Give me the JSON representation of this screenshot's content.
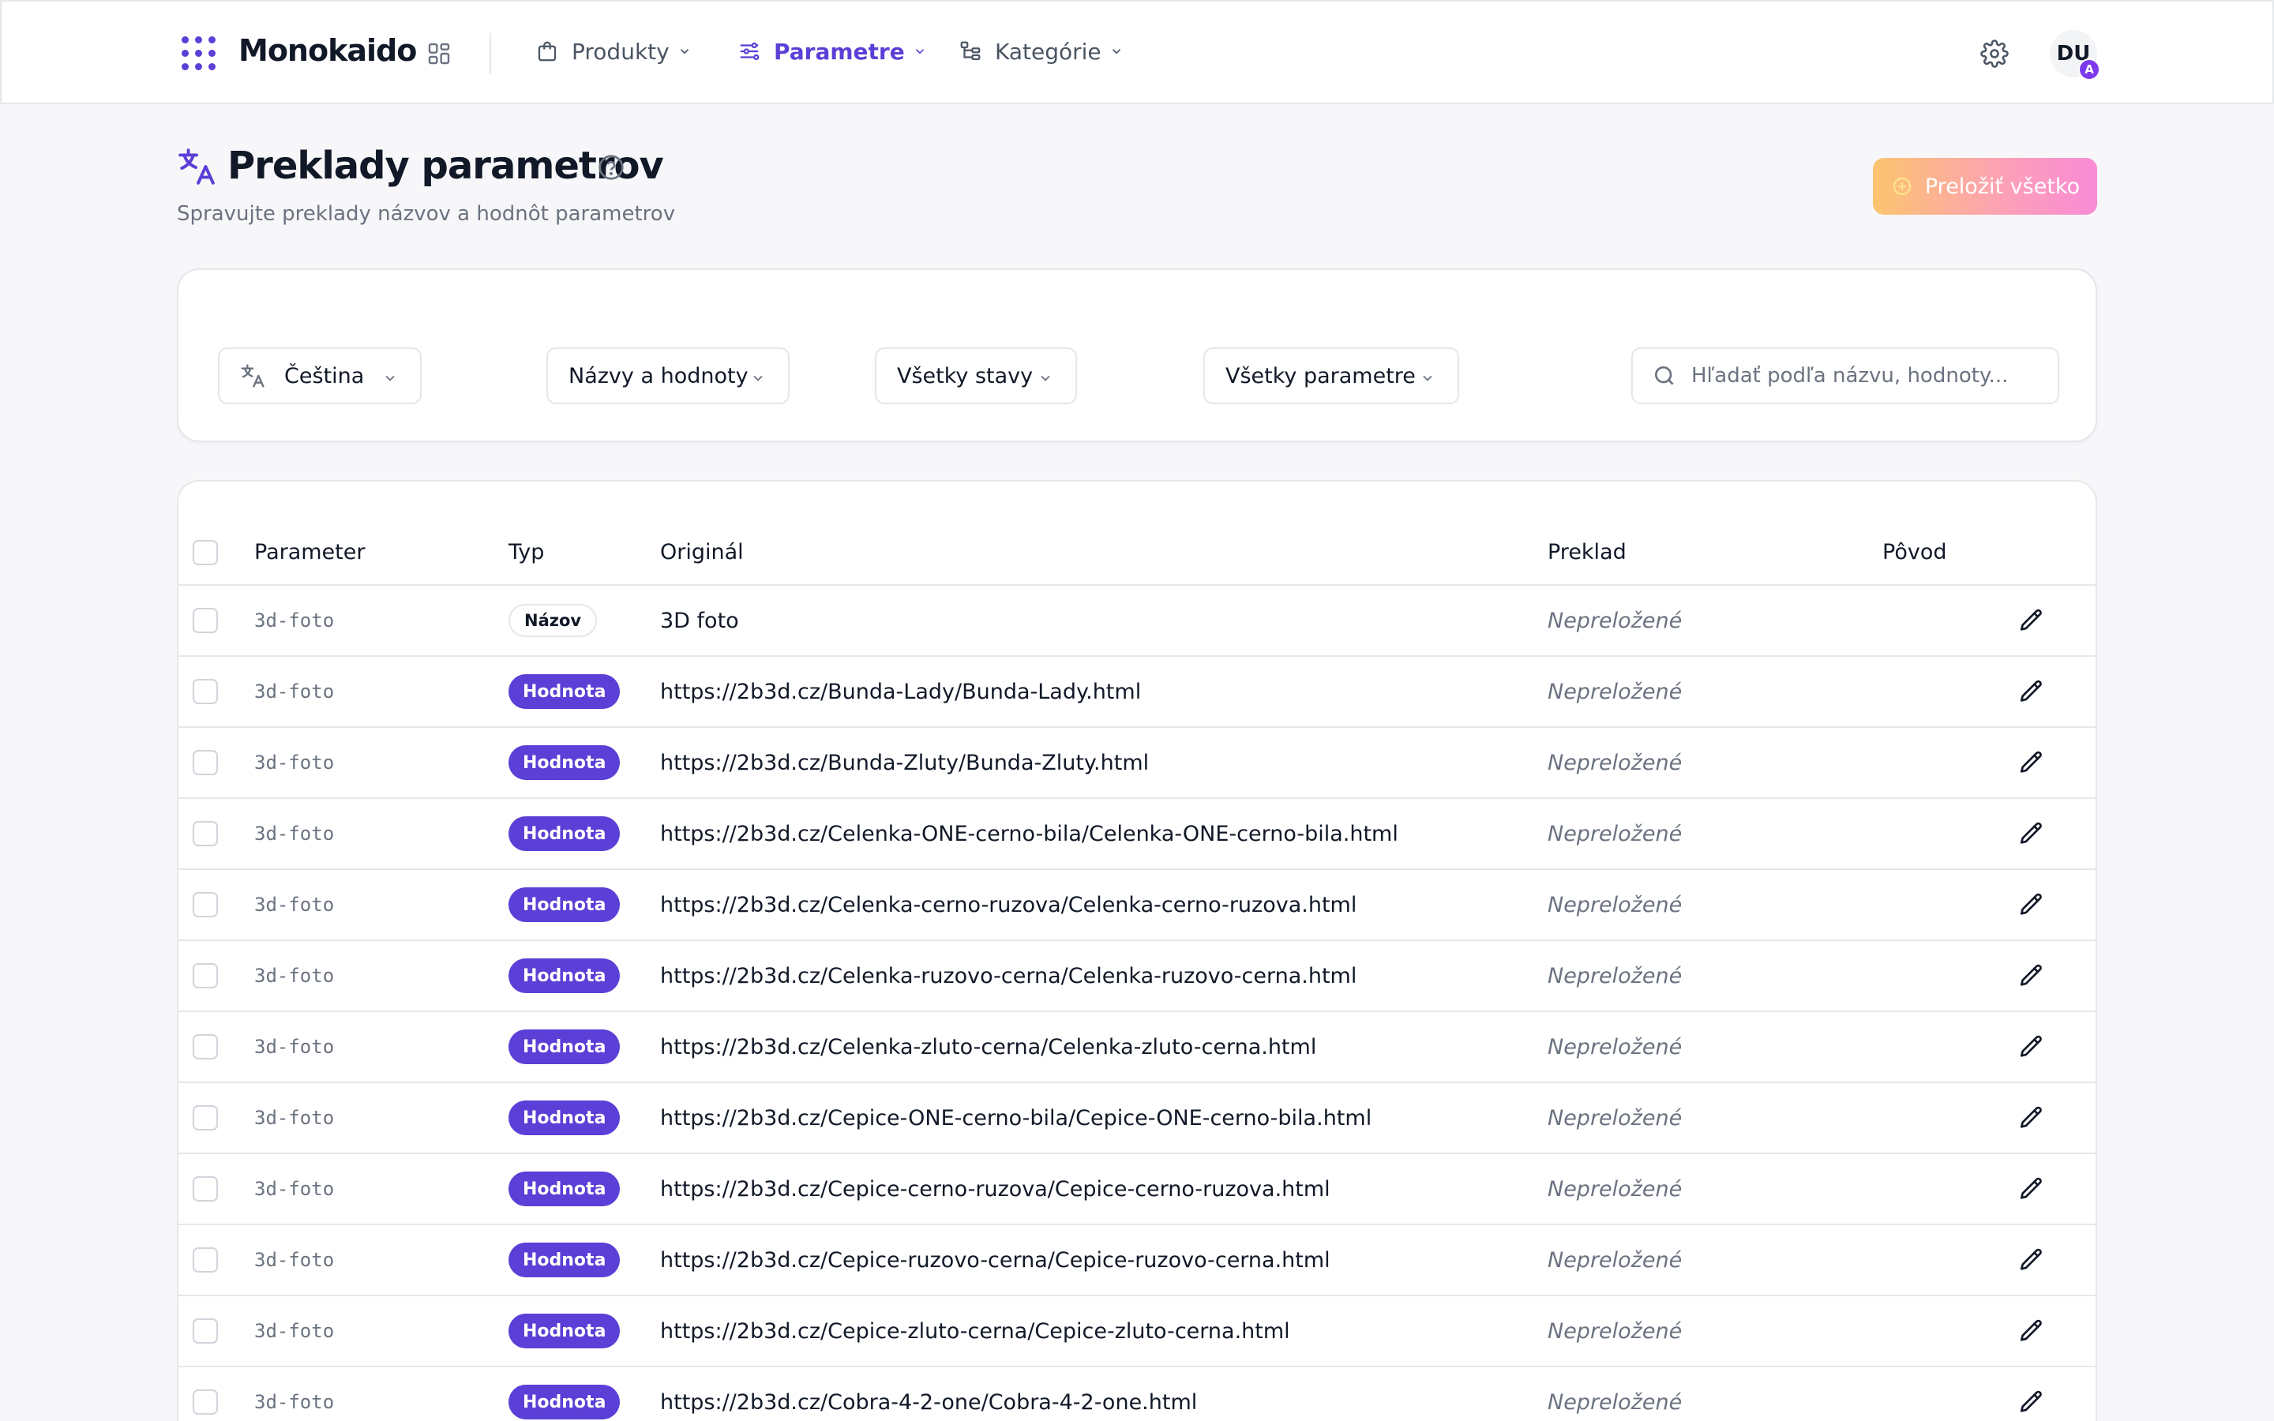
{
  "header": {
    "brand": "Monokaido",
    "nav": [
      {
        "label": "Produkty",
        "icon": "shopping-bag-icon",
        "active": false
      },
      {
        "label": "Parametre",
        "icon": "sliders-icon",
        "active": true
      },
      {
        "label": "Kategórie",
        "icon": "tree-structure-icon",
        "active": false
      }
    ],
    "avatar_initials": "DU",
    "avatar_badge": "A"
  },
  "page": {
    "title": "Preklady parametrov",
    "subtitle": "Spravujte preklady názvov a hodnôt parametrov",
    "translate_all_label": "Preložiť všetko"
  },
  "filters": {
    "language": "Čeština",
    "scope": "Názvy a hodnoty",
    "status": "Všetky stavy",
    "parameters": "Všetky parametre",
    "search_placeholder": "Hľadať podľa názvu, hodnoty..."
  },
  "table": {
    "columns": {
      "parameter": "Parameter",
      "type": "Typ",
      "original": "Originál",
      "translation": "Preklad",
      "source": "Pôvod"
    },
    "rows": [
      {
        "parameter": "3d-foto",
        "type": "Názov",
        "kind": "name",
        "original": "3D foto",
        "translation": "Nepreložené"
      },
      {
        "parameter": "3d-foto",
        "type": "Hodnota",
        "kind": "value",
        "original": "https://2b3d.cz/Bunda-Lady/Bunda-Lady.html",
        "translation": "Nepreložené"
      },
      {
        "parameter": "3d-foto",
        "type": "Hodnota",
        "kind": "value",
        "original": "https://2b3d.cz/Bunda-Zluty/Bunda-Zluty.html",
        "translation": "Nepreložené"
      },
      {
        "parameter": "3d-foto",
        "type": "Hodnota",
        "kind": "value",
        "original": "https://2b3d.cz/Celenka-ONE-cerno-bila/Celenka-ONE-cerno-bila.html",
        "translation": "Nepreložené"
      },
      {
        "parameter": "3d-foto",
        "type": "Hodnota",
        "kind": "value",
        "original": "https://2b3d.cz/Celenka-cerno-ruzova/Celenka-cerno-ruzova.html",
        "translation": "Nepreložené"
      },
      {
        "parameter": "3d-foto",
        "type": "Hodnota",
        "kind": "value",
        "original": "https://2b3d.cz/Celenka-ruzovo-cerna/Celenka-ruzovo-cerna.html",
        "translation": "Nepreložené"
      },
      {
        "parameter": "3d-foto",
        "type": "Hodnota",
        "kind": "value",
        "original": "https://2b3d.cz/Celenka-zluto-cerna/Celenka-zluto-cerna.html",
        "translation": "Nepreložené"
      },
      {
        "parameter": "3d-foto",
        "type": "Hodnota",
        "kind": "value",
        "original": "https://2b3d.cz/Cepice-ONE-cerno-bila/Cepice-ONE-cerno-bila.html",
        "translation": "Nepreložené"
      },
      {
        "parameter": "3d-foto",
        "type": "Hodnota",
        "kind": "value",
        "original": "https://2b3d.cz/Cepice-cerno-ruzova/Cepice-cerno-ruzova.html",
        "translation": "Nepreložené"
      },
      {
        "parameter": "3d-foto",
        "type": "Hodnota",
        "kind": "value",
        "original": "https://2b3d.cz/Cepice-ruzovo-cerna/Cepice-ruzovo-cerna.html",
        "translation": "Nepreložené"
      },
      {
        "parameter": "3d-foto",
        "type": "Hodnota",
        "kind": "value",
        "original": "https://2b3d.cz/Cepice-zluto-cerna/Cepice-zluto-cerna.html",
        "translation": "Nepreložené"
      },
      {
        "parameter": "3d-foto",
        "type": "Hodnota",
        "kind": "value",
        "original": "https://2b3d.cz/Cobra-4-2-one/Cobra-4-2-one.html",
        "translation": "Nepreložené"
      }
    ]
  },
  "colors": {
    "accent": "#5b3fd6",
    "gradient_start": "#fcc46f",
    "gradient_end": "#f98bd6",
    "border": "#e5e7eb",
    "muted_text": "#6b7280"
  }
}
